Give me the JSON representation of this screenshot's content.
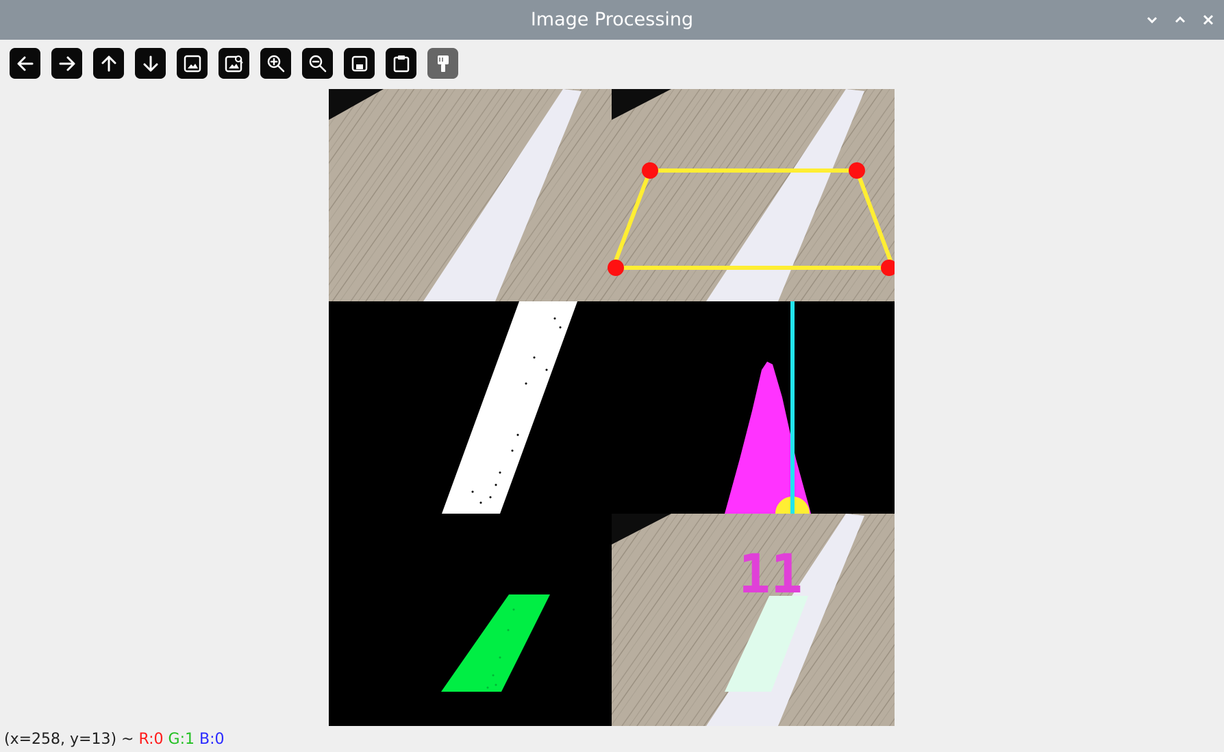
{
  "window": {
    "title": "Image Processing",
    "controls": [
      "minimize",
      "maximize",
      "close"
    ]
  },
  "toolbar": {
    "buttons": [
      {
        "name": "pan-left",
        "icon": "arrow-left-icon"
      },
      {
        "name": "pan-right",
        "icon": "arrow-right-icon"
      },
      {
        "name": "pan-up",
        "icon": "arrow-up-icon"
      },
      {
        "name": "pan-down",
        "icon": "arrow-down-icon"
      },
      {
        "name": "zoom-fit",
        "icon": "image-icon"
      },
      {
        "name": "zoom-original",
        "icon": "image-search-icon"
      },
      {
        "name": "zoom-in",
        "icon": "zoom-in-icon"
      },
      {
        "name": "zoom-out",
        "icon": "zoom-out-icon"
      },
      {
        "name": "save",
        "icon": "save-icon"
      },
      {
        "name": "copy-clipboard",
        "icon": "clipboard-icon"
      },
      {
        "name": "properties",
        "icon": "paint-brush-icon",
        "disabled": true
      }
    ]
  },
  "image": {
    "overlay_number": "11",
    "colors": {
      "wood": "#b8ae9f",
      "tape": "#ececf4",
      "poly_line": "#ffee33",
      "poly_point": "#ff1111",
      "histogram": "#ff33ff",
      "center_line": "#22e4ee",
      "mask_green": "#00ee44",
      "overlay_text": "#e040d8"
    }
  },
  "status": {
    "coords": "(x=258, y=13) ~",
    "r": "R:0",
    "g": "G:1",
    "b": "B:0"
  }
}
